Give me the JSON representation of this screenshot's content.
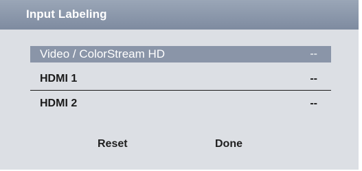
{
  "dialog": {
    "title": "Input Labeling"
  },
  "inputs": [
    {
      "label": "Video / ColorStream HD",
      "value": "--",
      "selected": true
    },
    {
      "label": "HDMI 1",
      "value": "--",
      "selected": false
    },
    {
      "label": "HDMI 2",
      "value": "--",
      "selected": false
    }
  ],
  "buttons": {
    "reset_label": "Reset",
    "done_label": "Done"
  },
  "colors": {
    "title_bar": "#8794a8",
    "panel_background": "#dcdfe4",
    "selected_row": "#8a95a8"
  }
}
